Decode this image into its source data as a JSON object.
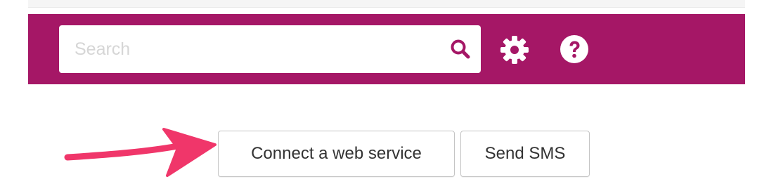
{
  "toolbar": {
    "background_color": "#a51766",
    "search": {
      "placeholder": "Search",
      "value": "",
      "icon": "search-icon",
      "icon_color": "#a51766"
    },
    "settings_icon": "gear-icon",
    "help_icon": "question-circle-icon",
    "icon_color": "#ffffff"
  },
  "actions": {
    "connect_web_service_label": "Connect a web service",
    "send_sms_label": "Send SMS"
  },
  "annotation": {
    "type": "arrow",
    "color": "#f0366a",
    "points_to": "connect-web-service-button"
  }
}
